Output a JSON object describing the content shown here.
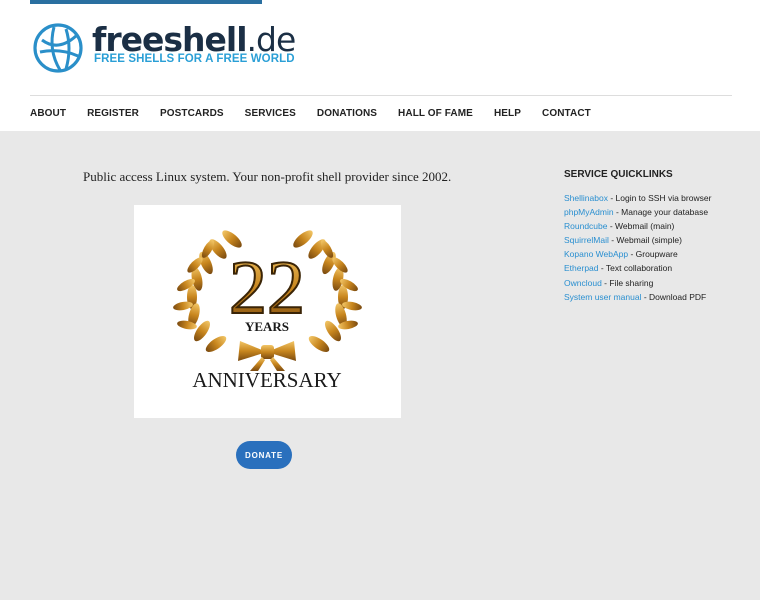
{
  "brand": {
    "name": "freeshell",
    "tld": ".de",
    "tagline": "FREE SHELLS FOR A FREE WORLD",
    "logo_icon": "globe-icon"
  },
  "nav": {
    "items": [
      "ABOUT",
      "REGISTER",
      "POSTCARDS",
      "SERVICES",
      "DONATIONS",
      "HALL OF FAME",
      "HELP",
      "CONTACT"
    ]
  },
  "main": {
    "tagline": "Public access Linux system. Your non-profit shell provider since 2002.",
    "anniversary": {
      "number": "22",
      "years": "YEARS",
      "label": "ANNIVERSARY"
    },
    "donate_label": "DONATE"
  },
  "quicklinks": {
    "title": "SERVICE QUICKLINKS",
    "items": [
      {
        "link": "Shellinabox",
        "desc": " - Login to SSH via browser"
      },
      {
        "link": "phpMyAdmin",
        "desc": " - Manage your database"
      },
      {
        "link": "Roundcube",
        "desc": " - Webmail (main)"
      },
      {
        "link": "SquirrelMail",
        "desc": " - Webmail (simple)"
      },
      {
        "link": "Kopano WebApp",
        "desc": " - Groupware"
      },
      {
        "link": "Etherpad",
        "desc": " - Text collaboration"
      },
      {
        "link": "Owncloud",
        "desc": " - File sharing"
      },
      {
        "link": "System user manual",
        "desc": " - Download PDF"
      }
    ]
  },
  "colors": {
    "accent": "#2a70bd",
    "link": "#2a8fd0",
    "gold": "#c8861e",
    "background": "#e8e8e8"
  }
}
